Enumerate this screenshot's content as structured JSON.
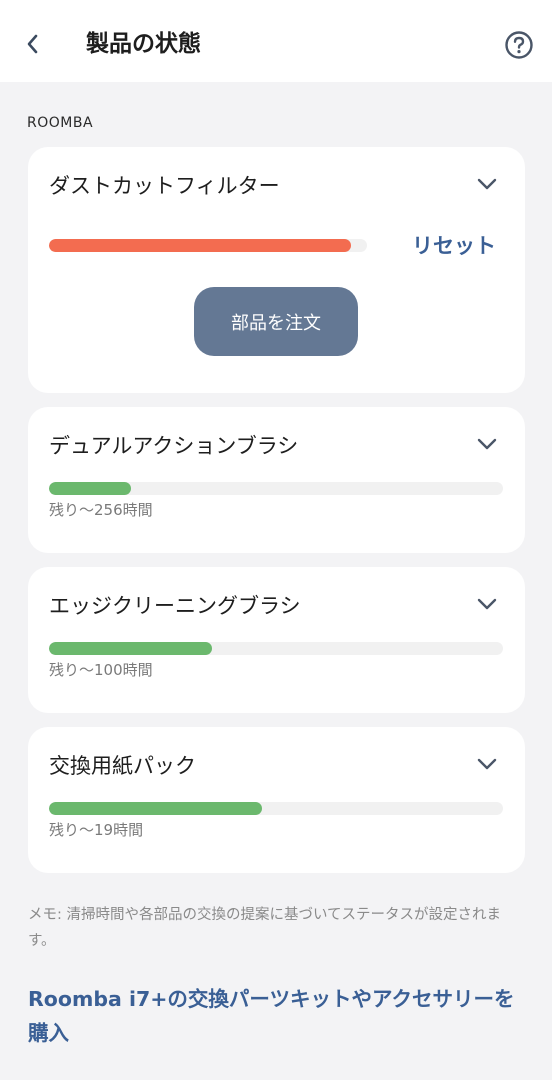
{
  "header": {
    "title": "製品の状態",
    "back_icon": "chevron-left-icon",
    "help_icon": "question-circle-icon"
  },
  "section": {
    "label": "ROOMBA"
  },
  "parts": [
    {
      "name": "ダストカットフィルター",
      "level": 0.95,
      "color": "#f36c50",
      "reset_label": "リセット",
      "order_label": "部品を注文"
    },
    {
      "name": "デュアルアクションブラシ",
      "level": 0.18,
      "color": "#6bb86d",
      "remaining": "残り〜256時間"
    },
    {
      "name": "エッジクリーニングブラシ",
      "level": 0.36,
      "color": "#6bb86d",
      "remaining": "残り〜100時間"
    },
    {
      "name": "交換用紙パック",
      "level": 0.47,
      "color": "#6bb86d",
      "remaining": "残り〜19時間"
    }
  ],
  "note": "メモ: 清掃時間や各部品の交換の提案に基づいてステータスが設定されます。",
  "buy_link": "Roomba i7+の交換パーツキットやアクセサリーを購入",
  "colors": {
    "accent": "#3a5f95",
    "button": "#647894",
    "warning": "#f36c50",
    "ok": "#6bb86d"
  }
}
